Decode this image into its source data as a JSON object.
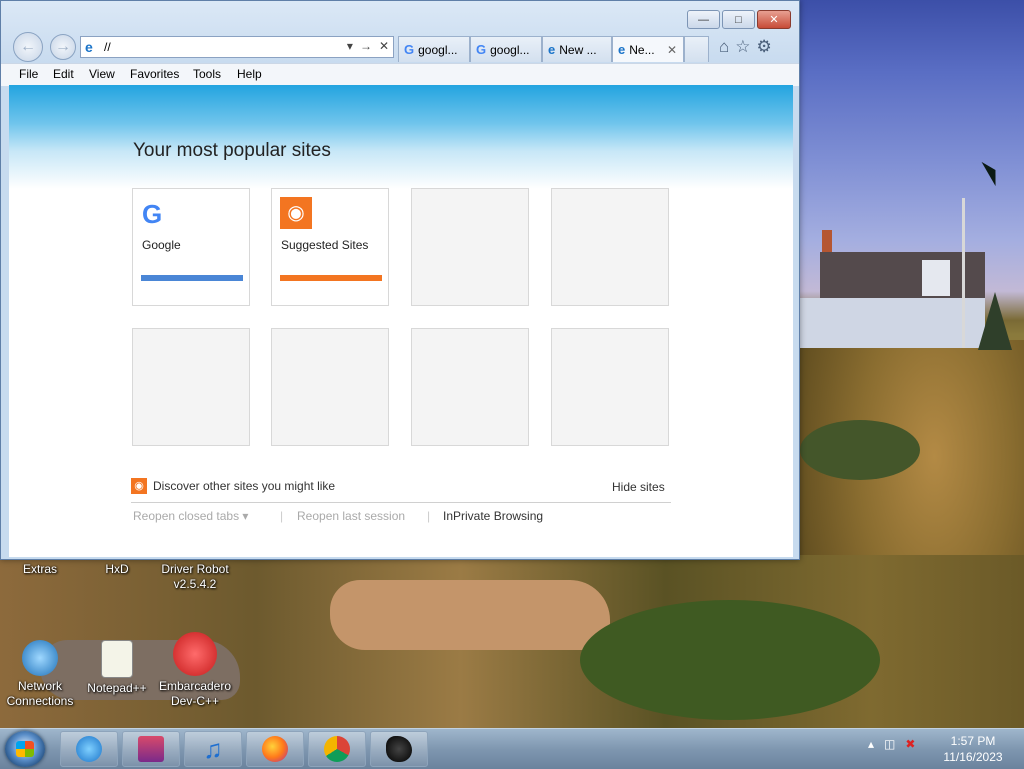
{
  "browser": {
    "address": "//",
    "tabs": [
      "googl...",
      "googl...",
      "New ...",
      "Ne..."
    ],
    "menu": [
      "File",
      "Edit",
      "View",
      "Favorites",
      "Tools",
      "Help"
    ]
  },
  "newtab": {
    "heading": "Your most popular sites",
    "tiles": [
      {
        "label": "Google",
        "bar_color": "#4a86d6"
      },
      {
        "label": "Suggested Sites",
        "bar_color": "#f37521"
      }
    ],
    "discover": "Discover other sites you might like",
    "hide": "Hide sites",
    "reopen_closed": "Reopen closed tabs",
    "reopen_last": "Reopen last session",
    "inprivate": "InPrivate Browsing"
  },
  "desktop_icons": [
    {
      "label": "Extras"
    },
    {
      "label": "HxD"
    },
    {
      "label": "Driver Robot v2.5.4.2"
    },
    {
      "label": "Network Connections"
    },
    {
      "label": "Notepad++"
    },
    {
      "label": "Embarcadero Dev-C++"
    }
  ],
  "clock": {
    "time": "1:57 PM",
    "date": "11/16/2023"
  },
  "colors": {
    "accent": "#1b74c9",
    "orange": "#f37521"
  }
}
